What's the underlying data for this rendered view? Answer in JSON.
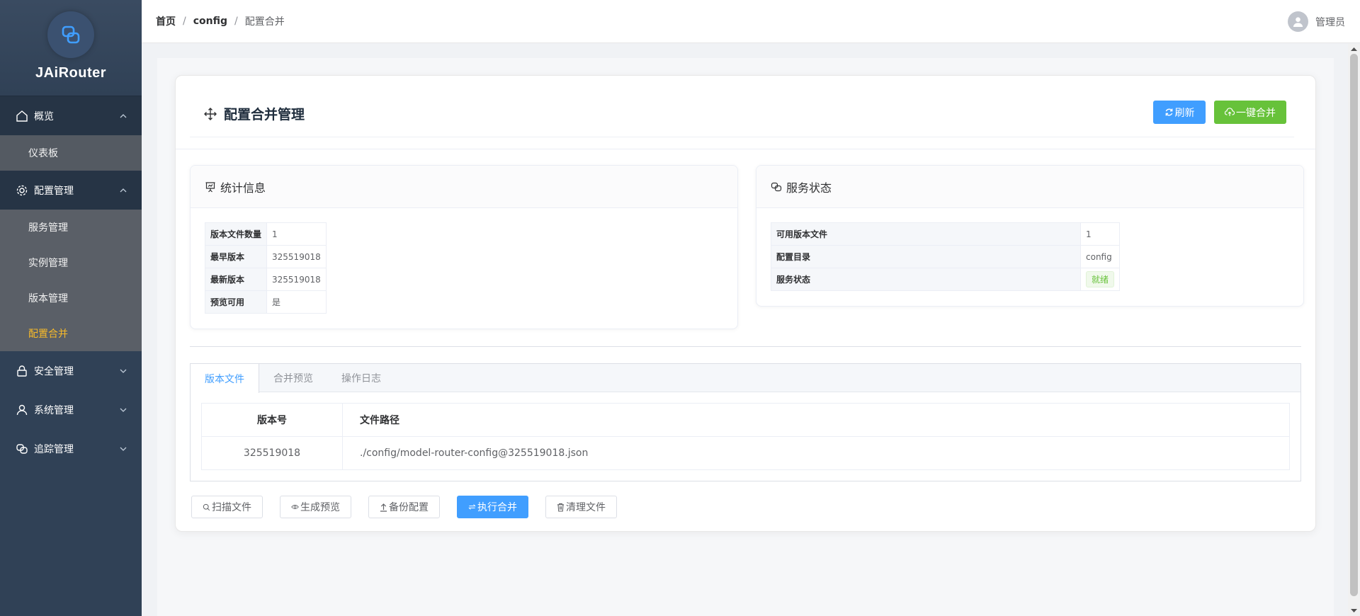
{
  "app": {
    "name": "JAiRouter"
  },
  "sidebar": {
    "groups": [
      {
        "label": "概览",
        "icon": "home-icon",
        "expanded": true,
        "items": [
          {
            "label": "仪表板"
          }
        ]
      },
      {
        "label": "配置管理",
        "icon": "gear-icon",
        "expanded": true,
        "items": [
          {
            "label": "服务管理"
          },
          {
            "label": "实例管理"
          },
          {
            "label": "版本管理"
          },
          {
            "label": "配置合并",
            "active": true
          }
        ]
      },
      {
        "label": "安全管理",
        "icon": "lock-icon",
        "expanded": false
      },
      {
        "label": "系统管理",
        "icon": "user-icon",
        "expanded": false
      },
      {
        "label": "追踪管理",
        "icon": "link-icon",
        "expanded": false
      }
    ]
  },
  "header": {
    "breadcrumb": [
      "首页",
      "config",
      "配置合并"
    ],
    "separator": "/",
    "user": "管理员"
  },
  "page": {
    "title": "配置合并管理",
    "refresh_label": "刷新",
    "merge_all_label": "一键合并"
  },
  "stats": {
    "title": "统计信息",
    "rows": [
      {
        "key": "版本文件数量",
        "value": "1"
      },
      {
        "key": "最早版本",
        "value": "325519018"
      },
      {
        "key": "最新版本",
        "value": "325519018"
      },
      {
        "key": "预览可用",
        "value": "是"
      }
    ]
  },
  "service": {
    "title": "服务状态",
    "rows": [
      {
        "key": "可用版本文件",
        "value": "1"
      },
      {
        "key": "配置目录",
        "value": "config"
      },
      {
        "key": "服务状态",
        "value": "就绪"
      }
    ]
  },
  "tabs": {
    "items": [
      "版本文件",
      "合并预览",
      "操作日志"
    ],
    "active": 0,
    "table": {
      "columns": [
        "版本号",
        "文件路径"
      ],
      "rows": [
        [
          "325519018",
          "./config/model-router-config@325519018.json"
        ]
      ]
    }
  },
  "actions": {
    "scan": "扫描文件",
    "preview": "生成预览",
    "backup": "备份配置",
    "merge": "执行合并",
    "clean": "清理文件"
  },
  "colors": {
    "primary": "#409eff",
    "success": "#67c23a",
    "sidebar": "#304156",
    "active_menu": "#f7ba2a"
  }
}
